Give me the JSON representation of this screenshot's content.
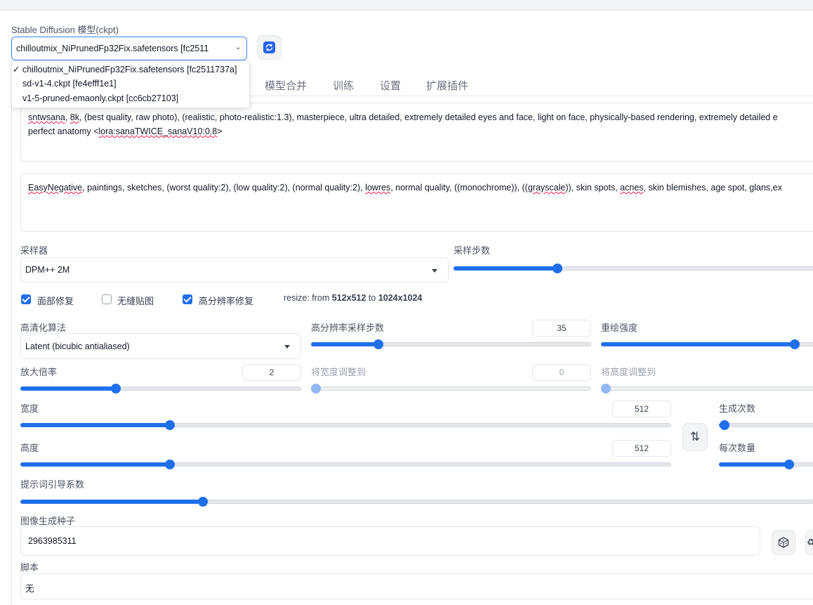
{
  "model": {
    "label": "Stable Diffusion 模型(ckpt)",
    "selected": "chilloutmix_NiPrunedFp32Fix.safetensors [fc2511",
    "options": [
      {
        "check": "✓",
        "label": "chilloutmix_NiPrunedFp32Fix.safetensors [fc2511737a]"
      },
      {
        "check": "",
        "label": "sd-v1-4.ckpt [fe4efff1e1]"
      },
      {
        "check": "",
        "label": "v1-5-pruned-emaonly.ckpt [cc6cb27103]"
      }
    ]
  },
  "tabs": [
    "模型合并",
    "训练",
    "设置",
    "扩展插件"
  ],
  "prompt": {
    "line1_parts": [
      "sntwsana",
      ", ",
      "8k",
      ", (best quality, raw photo), (realistic, photo-realistic:1.3), masterpiece, ultra detailed, extremely detailed eyes and face, light on face, physically-based rendering, extremely detailed e"
    ],
    "line2_parts": [
      "perfect anatomy <",
      "lora:sanaTWICE_sanaV10:0.8",
      ">"
    ]
  },
  "negative_prompt": {
    "parts": [
      "EasyNegative",
      ", paintings, sketches, (worst quality:2), (low quality:2), (normal quality:2), ",
      "lowres",
      ", normal quality, ((monochrome)), ((",
      "grayscale",
      ")), skin spots, ",
      "acnes",
      ", skin blemishes, age spot, glans,ex"
    ]
  },
  "sampler": {
    "label": "采样器",
    "value": "DPM++ 2M"
  },
  "steps": {
    "label": "采样步数",
    "level": 0.28
  },
  "checkboxes": [
    {
      "label": "面部修复",
      "checked": true
    },
    {
      "label": "无缝贴图",
      "checked": false
    },
    {
      "label": "高分辨率修复",
      "checked": true
    }
  ],
  "resize": {
    "prefix": "resize: from ",
    "from": "512x512",
    "mid": " to ",
    "to": "1024x1024"
  },
  "hires": {
    "upscaler_label": "高清化算法",
    "upscaler_value": "Latent (bicubic antialiased)",
    "steps_label": "高分辨率采样步数",
    "steps_value": "35",
    "steps_level": 0.24,
    "denoise_label": "重绘强度",
    "denoise_level": 0.9,
    "scale_label": "放大倍率",
    "scale_value": "2",
    "scale_level": 0.34,
    "resize_w_label": "将宽度调整到",
    "resize_w_value": "0",
    "resize_h_label": "将高度调整到"
  },
  "width": {
    "label": "宽度",
    "value": "512",
    "level": 0.23
  },
  "height": {
    "label": "高度",
    "value": "512",
    "level": 0.23
  },
  "swap_icon": "⇅",
  "batch_count": {
    "label": "生成次数",
    "level": 0.05
  },
  "batch_size": {
    "label": "每次数量",
    "level": 0.7
  },
  "cfg": {
    "label": "提示词引导系数",
    "level": 0.23
  },
  "seed": {
    "label": "图像生成种子",
    "value": "2963985311"
  },
  "script": {
    "label": "脚本",
    "value": "无"
  },
  "colors": {
    "accent": "#1f6feb",
    "refresh_icon": "#2563eb"
  }
}
